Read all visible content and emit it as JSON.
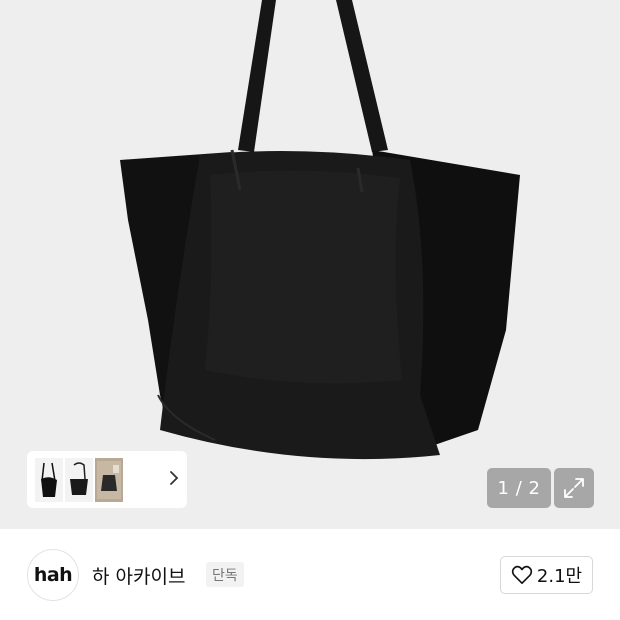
{
  "product": {
    "image": "black-leather-tote-bag",
    "thumbnails": [
      "black-bag-thumb-1",
      "black-bag-thumb-2",
      "bag-photo-thumb-3"
    ],
    "counter": "1 / 2"
  },
  "seller": {
    "logo_text": "hah",
    "name": "하 아카이브",
    "badge": "단독"
  },
  "like": {
    "count": "2.1만",
    "icon": "heart-outline-icon"
  },
  "colors": {
    "hero_bg": "#eeeeee",
    "bag": "#141414"
  }
}
